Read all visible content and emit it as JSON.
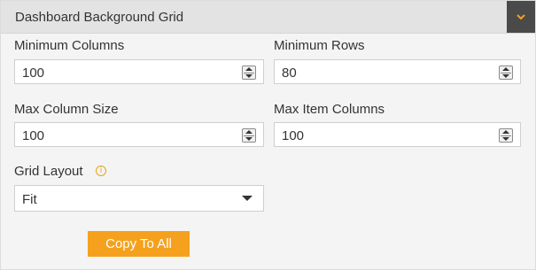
{
  "panel": {
    "title": "Dashboard Background Grid",
    "collapse_icon": "chevron-down-icon",
    "accent_color": "#f5a11d",
    "header_button_color": "#4a4a4a"
  },
  "fields": {
    "min_columns": {
      "label": "Minimum Columns",
      "value": "100"
    },
    "min_rows": {
      "label": "Minimum Rows",
      "value": "80"
    },
    "max_column_size": {
      "label": "Max Column Size",
      "value": "100"
    },
    "max_item_columns": {
      "label": "Max Item Columns",
      "value": "100"
    },
    "grid_layout": {
      "label": "Grid Layout",
      "value": "Fit",
      "info_icon": "info-icon"
    }
  },
  "actions": {
    "copy_to_all": "Copy To All"
  }
}
